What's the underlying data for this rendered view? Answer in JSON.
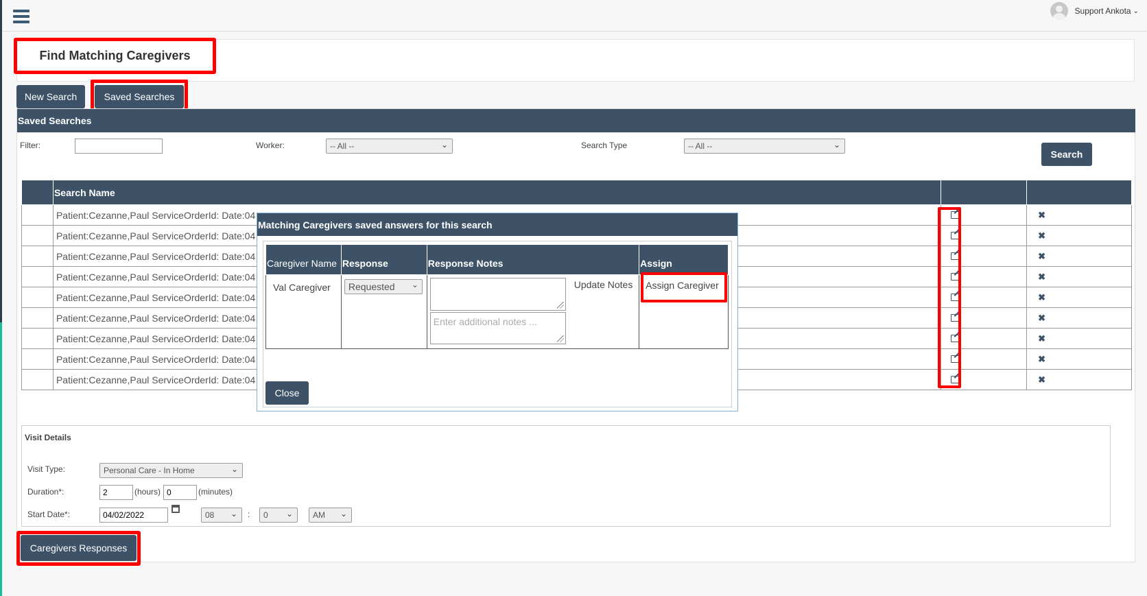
{
  "header": {
    "user_name": "Support Ankota"
  },
  "page": {
    "title": "Find Matching Caregivers"
  },
  "tabs": {
    "new_search": "New Search",
    "saved_searches": "Saved Searches"
  },
  "saved_panel": {
    "title": "Saved Searches",
    "filter_label": "Filter:",
    "filter_value": "",
    "worker_label": "Worker:",
    "worker_selected": "-- All --",
    "search_type_label": "Search Type",
    "search_type_selected": "-- All --",
    "search_button": "Search",
    "columns": [
      "",
      "Search Name",
      "",
      ""
    ],
    "rows": [
      {
        "name": "Patient:Cezanne,Paul ServiceOrderId: Date:04"
      },
      {
        "name": "Patient:Cezanne,Paul ServiceOrderId: Date:04"
      },
      {
        "name": "Patient:Cezanne,Paul ServiceOrderId: Date:04"
      },
      {
        "name": "Patient:Cezanne,Paul ServiceOrderId: Date:04"
      },
      {
        "name": "Patient:Cezanne,Paul ServiceOrderId: Date:04"
      },
      {
        "name": "Patient:Cezanne,Paul ServiceOrderId: Date:04"
      },
      {
        "name": "Patient:Cezanne,Paul ServiceOrderId: Date:04"
      },
      {
        "name": "Patient:Cezanne,Paul ServiceOrderId: Date:04"
      },
      {
        "name": "Patient:Cezanne,Paul ServiceOrderId: Date:04"
      }
    ]
  },
  "visit": {
    "title": "Visit Details",
    "visit_type_label": "Visit Type:",
    "visit_type_selected": "Personal Care - In Home",
    "duration_label": "Duration*:",
    "hours_value": "2",
    "hours_label": "(hours)",
    "minutes_value": "0",
    "minutes_label": "(minutes)",
    "start_date_label": "Start Date*:",
    "start_date_value": "04/02/2022",
    "hour_selected": "08",
    "colon": ":",
    "minute_selected": "0",
    "ampm_selected": "AM"
  },
  "responses_button": "Caregivers Responses",
  "modal": {
    "title": "Matching Caregivers saved answers for this search",
    "columns": {
      "caregiver_name": "Caregiver Name",
      "response": "Response",
      "response_notes": "Response Notes",
      "assign": "Assign"
    },
    "row": {
      "caregiver": "Val Caregiver",
      "response_selected": "Requested",
      "notes_value": "",
      "additional_notes_placeholder": "Enter additional notes ...",
      "update_notes": "Update Notes",
      "assign_caregiver": "Assign Caregiver"
    },
    "close_button": "Close"
  },
  "colors": {
    "header_bg": "#3d5266",
    "highlight": "#ff0000",
    "accent_green": "#1abc9c"
  }
}
